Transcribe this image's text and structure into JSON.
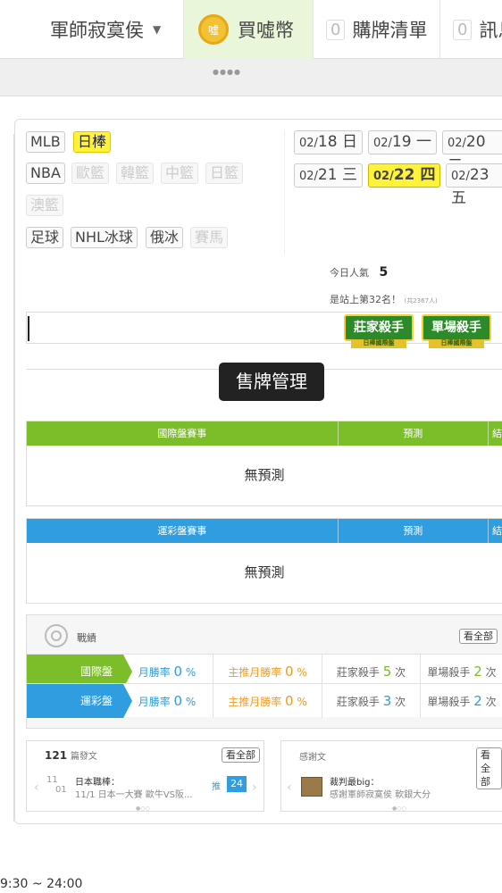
{
  "nav": {
    "user_name": "軍師寂寞侯",
    "coin_label": "買噓幣",
    "coin_icon_text": "噓",
    "cart_count": "0",
    "cart_label": "購牌清單",
    "msg_count": "0",
    "msg_label": "訊息"
  },
  "sports": {
    "row1": [
      "MLB",
      "日棒"
    ],
    "row2": [
      "NBA",
      "歐籃",
      "韓籃",
      "中籃",
      "日籃"
    ],
    "row3": [
      "澳籃"
    ],
    "row4": [
      "足球",
      "NHL冰球",
      "俄冰",
      "賽馬"
    ]
  },
  "dates": [
    {
      "md": "02/",
      "d": "18",
      "w": "日"
    },
    {
      "md": "02/",
      "d": "19",
      "w": "一"
    },
    {
      "md": "02/",
      "d": "20",
      "w": "二"
    },
    {
      "md": "02/",
      "d": "21",
      "w": "三"
    },
    {
      "md": "02/",
      "d": "22",
      "w": "四"
    },
    {
      "md": "02/",
      "d": "23",
      "w": "五"
    }
  ],
  "popularity": {
    "label": "今日人氣",
    "value": "5",
    "rank_text": "是站上第32名！",
    "rank_note": "(共2367人)"
  },
  "badges": {
    "banker": "莊家殺手",
    "banker_sub": "日棒國際盤",
    "single": "單場殺手",
    "single_sub": "日棒國際盤"
  },
  "tooltip": "售牌管理",
  "intl_table": {
    "col1": "國際盤賽事",
    "col2": "預測",
    "col3": "結",
    "empty": "無預測",
    "color": "#7cbd2a"
  },
  "lottery_table": {
    "col1": "運彩盤賽事",
    "col2": "預測",
    "col3": "結",
    "empty": "無預測",
    "color": "#2f9de0"
  },
  "stats": {
    "title": "戰績",
    "view_all": "看全部",
    "rows": [
      {
        "label": "國際盤",
        "win_label": "月勝率",
        "win": "0",
        "main_label": "主推月勝率",
        "main": "0",
        "banker_label": "莊家殺手",
        "banker": "5",
        "single_label": "單場殺手",
        "single": "2",
        "unit": "次",
        "pct": "%"
      },
      {
        "label": "運彩盤",
        "win_label": "月勝率",
        "win": "0",
        "main_label": "主推月勝率",
        "main": "0",
        "banker_label": "莊家殺手",
        "banker": "3",
        "single_label": "單場殺手",
        "single": "2",
        "unit": "次",
        "pct": "%"
      }
    ]
  },
  "posts": {
    "count": "121",
    "label": "篇發文",
    "view_all": "看全部",
    "date_top": "11",
    "date_bottom": "01",
    "title": "日本職棒：",
    "desc": "11/1 日本一大賽 歐牛VS阪...",
    "push_label": "推",
    "push_count": "24"
  },
  "thanks": {
    "title": "感謝文",
    "view_all": "看全部",
    "author": "裁判最big：",
    "desc": "感謝軍師寂寞侯 軟銀大分"
  },
  "footer": {
    "time": "9:30 ~ 24:00"
  }
}
